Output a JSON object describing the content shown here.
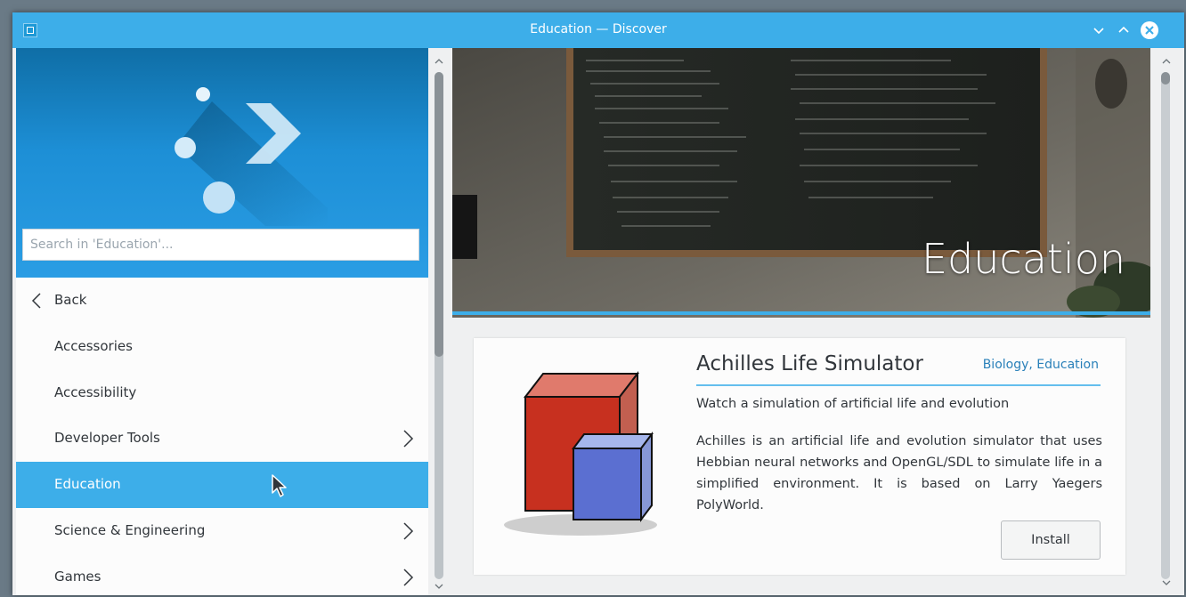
{
  "window": {
    "title": "Education — Discover",
    "accent_color": "#3daee9"
  },
  "sidebar": {
    "search": {
      "placeholder": "Search in 'Education'..."
    },
    "back_label": "Back",
    "items": [
      {
        "label": "Accessories",
        "has_children": false,
        "selected": false
      },
      {
        "label": "Accessibility",
        "has_children": false,
        "selected": false
      },
      {
        "label": "Developer Tools",
        "has_children": true,
        "selected": false
      },
      {
        "label": "Education",
        "has_children": false,
        "selected": true
      },
      {
        "label": "Science & Engineering",
        "has_children": true,
        "selected": false
      },
      {
        "label": "Games",
        "has_children": true,
        "selected": false
      }
    ]
  },
  "banner": {
    "title": "Education"
  },
  "app_card": {
    "name": "Achilles Life Simulator",
    "categories": "Biology, Education",
    "summary": "Watch a simulation of artificial life and evolution",
    "description": "Achilles is an artificial life and evolution simulator that uses Hebbian neural networks and OpenGL/SDL to simulate life in a simplified environment. It is based on Larry Yaegers PolyWorld.",
    "install_label": "Install"
  },
  "icons": [
    "app-icon",
    "minimize-icon",
    "maximize-icon",
    "close-icon",
    "back-chevron-icon",
    "chevron-right-icon",
    "discover-logo-icon",
    "achilles-cubes-icon",
    "mouse-cursor-icon"
  ]
}
